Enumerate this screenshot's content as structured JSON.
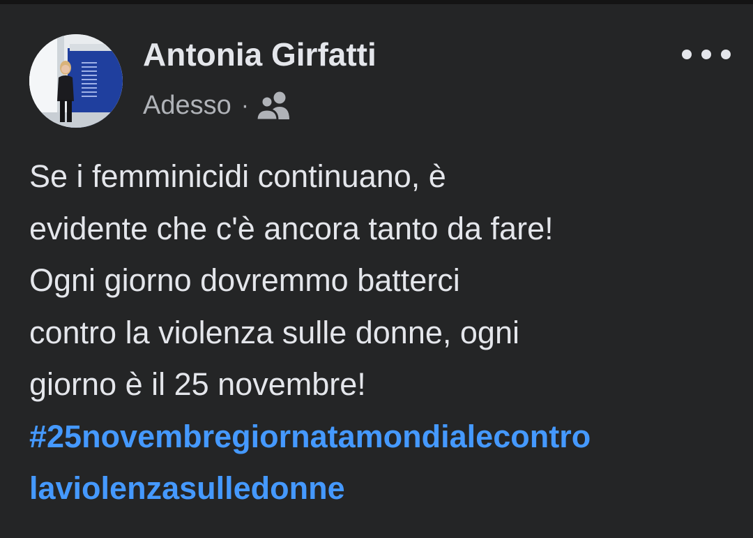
{
  "post": {
    "author_name": "Antonia Girfatti",
    "timestamp": "Adesso",
    "separator": "·",
    "audience_icon": "friends-icon",
    "more_icon": "more-options-icon",
    "body_lines": [
      "Se i femminicidi continuano, è",
      "evidente che c'è ancora tanto da fare!",
      "Ogni giorno dovremmo batterci",
      "contro la violenza sulle donne, ogni",
      "giorno è il 25 novembre!"
    ],
    "hashtag_lines": [
      "#25novembregiornatamondialecontro",
      "laviolenzasulledonne"
    ]
  },
  "colors": {
    "background": "#242526",
    "primary_text": "#e4e6eb",
    "secondary_text": "#b0b3b8",
    "link": "#4599ff"
  }
}
